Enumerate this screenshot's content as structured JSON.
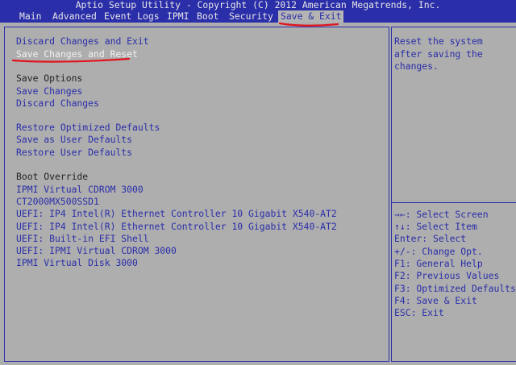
{
  "title": "Aptio Setup Utility - Copyright (C) 2012 American Megatrends, Inc.",
  "tabs": [
    {
      "label": "Main"
    },
    {
      "label": "Advanced"
    },
    {
      "label": "Event Logs"
    },
    {
      "label": "IPMI"
    },
    {
      "label": "Boot"
    },
    {
      "label": "Security"
    },
    {
      "label": "Save & Exit",
      "active": true
    }
  ],
  "menu": {
    "discard_exit": "Discard Changes and Exit",
    "save_reset": "Save Changes and Reset",
    "save_options_header": "Save Options",
    "save_changes": "Save Changes",
    "discard_changes": "Discard Changes",
    "restore_optimized": "Restore Optimized Defaults",
    "save_user_defaults": "Save as User Defaults",
    "restore_user_defaults": "Restore User Defaults",
    "boot_override_header": "Boot Override",
    "boot_items": [
      "IPMI Virtual CDROM 3000",
      "CT2000MX500SSD1",
      "UEFI: IP4 Intel(R) Ethernet Controller 10 Gigabit X540-AT2",
      "UEFI: IP4 Intel(R) Ethernet Controller 10 Gigabit X540-AT2",
      "UEFI: Built-in EFI Shell",
      "UEFI: IPMI Virtual CDROM 3000",
      "IPMI Virtual Disk 3000"
    ]
  },
  "help": {
    "lines": [
      "Reset the system",
      "after saving the",
      "changes."
    ]
  },
  "key_hints": [
    "→←: Select Screen",
    "↑↓: Select Item",
    "Enter: Select",
    "+/-: Change Opt.",
    "F1: General Help",
    "F2: Previous Values",
    "F3: Optimized Defaults",
    "F4: Save & Exit",
    "ESC: Exit"
  ],
  "colors": {
    "header_bg": "#2a2ea9",
    "panel_bg": "#aeaeae",
    "link_text": "#2a2ea9",
    "selected_text": "#f2f2f2",
    "annotation_red": "#e0141e"
  }
}
